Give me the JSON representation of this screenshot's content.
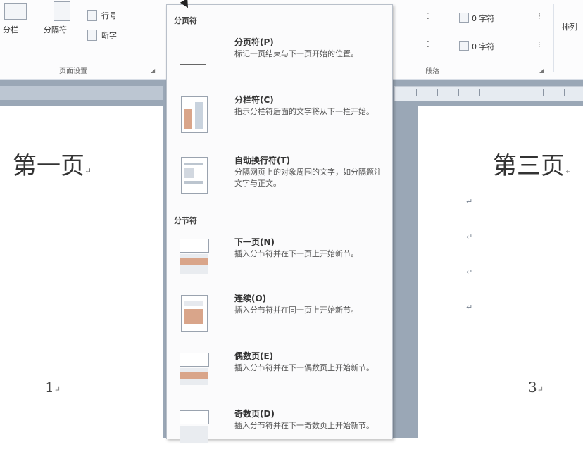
{
  "ribbon": {
    "btn_columns": "分栏",
    "btn_breaks": "分隔符",
    "btn_line_numbers": "行号",
    "btn_hyphen": "断字",
    "group_page_setup": "页面设置",
    "group_paragraph": "段落",
    "indent_left_value": "0 字符",
    "indent_right_value": "0 字符",
    "btn_arrange": "排列"
  },
  "menu": {
    "section_page_breaks": "分页符",
    "section_section_breaks": "分节符",
    "items": [
      {
        "title": "分页符(P)",
        "desc": "标记一页结束与下一页开始的位置。"
      },
      {
        "title": "分栏符(C)",
        "desc": "指示分栏符后面的文字将从下一栏开始。"
      },
      {
        "title": "自动换行符(T)",
        "desc": "分隔网页上的对象周围的文字，如分隔题注文字与正文。"
      },
      {
        "title": "下一页(N)",
        "desc": "插入分节符并在下一页上开始新节。"
      },
      {
        "title": "连续(O)",
        "desc": "插入分节符并在同一页上开始新节。"
      },
      {
        "title": "偶数页(E)",
        "desc": "插入分节符并在下一偶数页上开始新节。"
      },
      {
        "title": "奇数页(D)",
        "desc": "插入分节符并在下一奇数页上开始新节。"
      }
    ]
  },
  "document": {
    "page1_title": "第一页",
    "page1_number": "1",
    "page3_title": "第三页",
    "page3_number": "3",
    "return_mark": "↵"
  },
  "colors": {
    "ribbon_bg": "#fcfcfd",
    "workspace_bg": "#9aa7b6",
    "menu_bg": "#fbfbfc",
    "thumb_band": "#d9a58a"
  }
}
